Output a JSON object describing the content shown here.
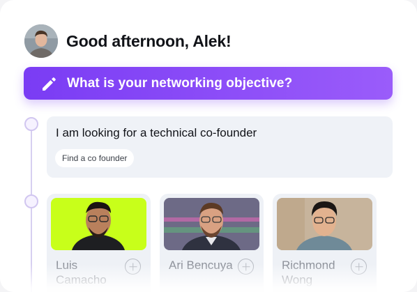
{
  "header": {
    "greeting": "Good afternoon, Alek!",
    "avatar_icon": "user-avatar"
  },
  "objective": {
    "label": "What is your networking objective?",
    "icon": "pencil-icon",
    "accent": "#8247f5"
  },
  "message": {
    "title": "I am looking for a technical co-founder",
    "chip": "Find a co founder"
  },
  "profiles": [
    {
      "name": "Luis Camacho",
      "bg": "#c8ff1a"
    },
    {
      "name": "Ari Bencuya",
      "bg": "#6d6a86"
    },
    {
      "name": "Richmond Wong",
      "bg": "#c7b49c"
    }
  ]
}
